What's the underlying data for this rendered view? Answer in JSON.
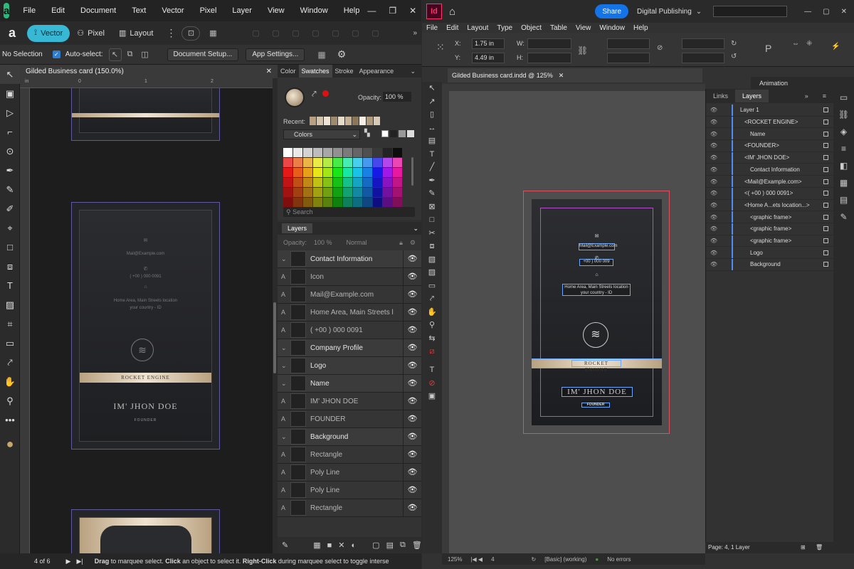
{
  "affinity": {
    "menu": [
      "File",
      "Edit",
      "Document",
      "Text",
      "Vector",
      "Pixel",
      "Layer",
      "View",
      "Window",
      "Help"
    ],
    "personas": {
      "vector": "Vector",
      "pixel": "Pixel",
      "layout": "Layout"
    },
    "context": {
      "selection": "No Selection",
      "autoselect": "Auto-select:",
      "doc_setup": "Document Setup...",
      "app_settings": "App Settings..."
    },
    "doc_tab": "Gilded Business card (150.0%)",
    "ruler_ticks": [
      "in",
      "0",
      "1",
      "2"
    ],
    "card": {
      "mail": "Mail@Example.com",
      "phone": "( +00 ) 000 0091",
      "address_1": "Home Area, Main Streets location",
      "address_2": "your country - ID",
      "band": "ROCKET ENGINE",
      "name": "IM' JHON DOE",
      "title": "FOUNDER"
    },
    "swatches": {
      "tabs": [
        "Color",
        "Swatches",
        "Stroke",
        "Appearance"
      ],
      "opacity_label": "Opacity:",
      "opacity_value": "100 %",
      "recent_label": "Recent:",
      "palette": "Colors",
      "search_placeholder": "Search"
    },
    "layers": {
      "title": "Layers",
      "opacity_label": "Opacity:",
      "opacity_value": "100 %",
      "blend": "Normal",
      "rows": [
        {
          "name": "Contact Information",
          "child": false
        },
        {
          "name": "Icon",
          "child": true
        },
        {
          "name": "Mail@Example.com",
          "child": true
        },
        {
          "name": "Home Area, Main Streets l",
          "child": true
        },
        {
          "name": "( +00 ) 000 0091",
          "child": true
        },
        {
          "name": "Company Profile",
          "child": false
        },
        {
          "name": "Logo",
          "child": false
        },
        {
          "name": "Name",
          "child": false
        },
        {
          "name": "IM' JHON DOE",
          "child": true
        },
        {
          "name": "FOUNDER",
          "child": true
        },
        {
          "name": "Background",
          "child": false
        },
        {
          "name": "Rectangle",
          "child": true
        },
        {
          "name": "Poly Line",
          "child": true
        },
        {
          "name": "Poly Line",
          "child": true
        },
        {
          "name": "Rectangle",
          "child": true
        }
      ]
    },
    "status": {
      "page": "4 of 6",
      "b1": "Drag",
      "t1": " to marquee select. ",
      "b2": "Click",
      "t2": " an object to select it. ",
      "b3": "Right-Click",
      "t3": " during marquee select to toggle interse"
    }
  },
  "indesign": {
    "logo": "Id",
    "share": "Share",
    "workspace": "Digital Publishing",
    "menu": [
      "File",
      "Edit",
      "Layout",
      "Type",
      "Object",
      "Table",
      "View",
      "Window",
      "Help"
    ],
    "control": {
      "x_label": "X:",
      "x": "1.75 in",
      "y_label": "Y:",
      "y": "4.49 in",
      "w_label": "W:",
      "h_label": "H:"
    },
    "doc_tab": "Gilded Business card.indd @ 125%",
    "card": {
      "mail": "Mail@Example.com",
      "phone": "+00 ) 000 009",
      "address_1": "Home Area, Main Streets location",
      "address_2": "your country - ID",
      "band": "ROCKET ENGINE",
      "name": "IM' JHON DOE",
      "title": "FOUNDER"
    },
    "animation": "Animation",
    "panel_tabs": [
      "Links",
      "Layers"
    ],
    "layers": [
      {
        "name": "Layer 1",
        "indent": 0
      },
      {
        "name": "<ROCKET ENGINE>",
        "indent": 2
      },
      {
        "name": "Name",
        "indent": 1
      },
      {
        "name": "<FOUNDER>",
        "indent": 2
      },
      {
        "name": "<IM' JHON DOE>",
        "indent": 2
      },
      {
        "name": "Contact Information",
        "indent": 1
      },
      {
        "name": "<Mail@Example.com>",
        "indent": 2
      },
      {
        "name": "<( +00 ) 000 0091>",
        "indent": 2
      },
      {
        "name": "<Home A...ets location...>",
        "indent": 2
      },
      {
        "name": "<graphic frame>",
        "indent": 1
      },
      {
        "name": "<graphic frame>",
        "indent": 1
      },
      {
        "name": "<graphic frame>",
        "indent": 1
      },
      {
        "name": "Logo",
        "indent": 1
      },
      {
        "name": "Background",
        "indent": 1
      }
    ],
    "layer_footer": "Page: 4, 1 Layer",
    "status": {
      "zoom": "125%",
      "page": "4",
      "style": "[Basic] (working)",
      "errors": "No errors"
    }
  },
  "colors": {
    "accent": "#37b9d6",
    "indesign_accent": "#ff3366",
    "gold": "#d9c7a8",
    "selection": "#6aa8ff"
  }
}
